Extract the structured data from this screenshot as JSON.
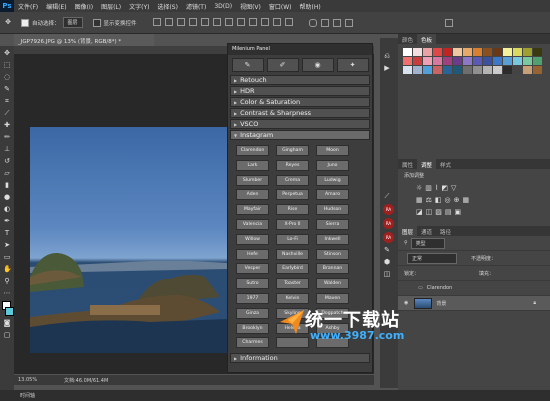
{
  "app_logo": "Ps",
  "menu": [
    "文件(F)",
    "编辑(E)",
    "图像(I)",
    "图层(L)",
    "文字(Y)",
    "选择(S)",
    "滤镜(T)",
    "3D(D)",
    "视图(V)",
    "窗口(W)",
    "帮助(H)"
  ],
  "options": {
    "auto_select": "自动选择：",
    "layer_value": "图层",
    "show_transform": "显示变换控件"
  },
  "doc_tab": "_JGP7926.JPG @ 13% (背景, RGB/8*) *",
  "status": {
    "zoom": "13.05%",
    "doc": "文档:46.0M/61.4M"
  },
  "timeline": "时间轴",
  "panel": {
    "title": "Milenium Panel",
    "sections_top": [
      "Retouch",
      "HDR",
      "Color & Saturation",
      "Contrast & Sharpness",
      "VSCO"
    ],
    "open_section": "Instagram",
    "filters": [
      "Clarendon",
      "Gingham",
      "Moon",
      "Lark",
      "Reyes",
      "Juno",
      "Slumber",
      "Crema",
      "Ludwig",
      "Aden",
      "Perpetua",
      "Amaro",
      "Mayfair",
      "Rise",
      "Hudson",
      "Valencia",
      "X-Pro II",
      "Sierra",
      "Willow",
      "Lo-Fi",
      "Inkwell",
      "Hefe",
      "Nashville",
      "Stinson",
      "Vesper",
      "Earlybird",
      "Brannan",
      "Sutro",
      "Toaster",
      "Walden",
      "1977",
      "Kelvin",
      "Maven",
      "Ginza",
      "Skyline",
      "Dogpatch",
      "Brooklyn",
      "Helena",
      "Ashby",
      "Charmes",
      "",
      ""
    ],
    "section_bottom": "Information"
  },
  "right": {
    "color_tabs": [
      "颜色",
      "色板"
    ],
    "swatches": [
      "#ffffff",
      "#f2dede",
      "#e9a3a3",
      "#e04848",
      "#c22424",
      "#f0c8a0",
      "#e8a868",
      "#d98030",
      "#8c4f1e",
      "#6a3814",
      "#f5f09a",
      "#dada60",
      "#a0a030",
      "#3a3a10",
      "#f07070",
      "#c83c3c",
      "#f0a0b4",
      "#d878a0",
      "#a04080",
      "#6c3c8c",
      "#8c78c8",
      "#5a5ab4",
      "#3c50a0",
      "#3c78c8",
      "#5aa0d8",
      "#78c8e0",
      "#78c8a0",
      "#50a070",
      "#d7e4f0",
      "#a0b4d2",
      "#50a0dc",
      "#c86464",
      "#286496",
      "#1e5a78",
      "#6e6e6e",
      "#909090",
      "#b4b4b4",
      "#cccccc",
      "#2c2c2c",
      "#444444",
      "#c8a078",
      "#966432"
    ],
    "adj_tabs": [
      "属性",
      "调整",
      "样式"
    ],
    "adj_label": "添加调整",
    "layers_tabs": [
      "图层",
      "通道",
      "路径"
    ],
    "layer_kind": "类型",
    "blend": "正常",
    "opacity_label": "不透明度：",
    "lock_label": "锁定：",
    "fill_label": "填充：",
    "layers": [
      {
        "name": "Clarendon",
        "type": "group"
      },
      {
        "name": "背景",
        "type": "image"
      }
    ]
  },
  "watermark": {
    "cn": "统一下载站",
    "url": "www.3987.com"
  }
}
